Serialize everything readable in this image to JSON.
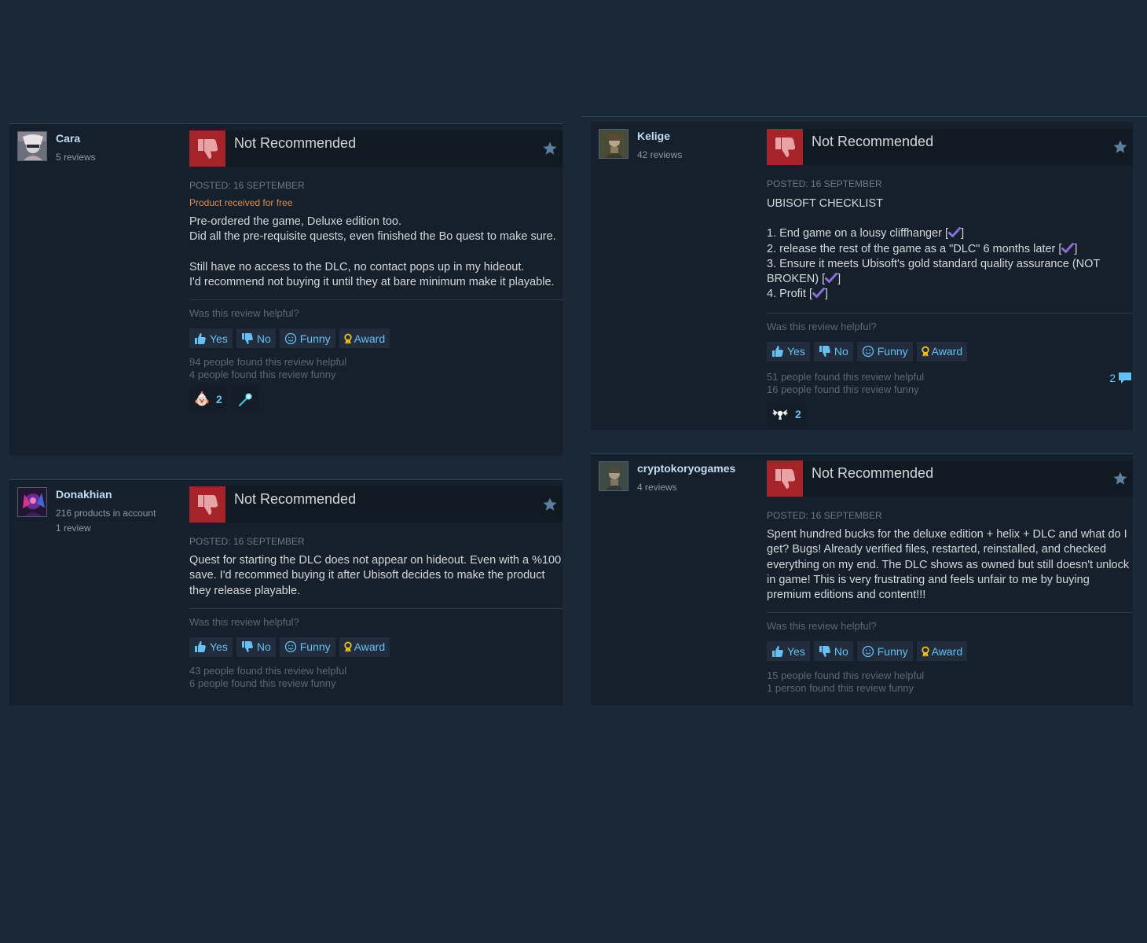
{
  "reviews": [
    {
      "author": {
        "name": "Cara",
        "meta": [
          "5 reviews"
        ]
      },
      "title": "Not Recommended",
      "posted": "POSTED: 16 SEPTEMBER",
      "free_flag": "Product received for free",
      "paragraphs": [
        [
          "Pre-ordered the game, Deluxe edition too.",
          "Did all the pre-requisite quests, even finished the Bo quest to make sure."
        ],
        [
          "Still have no access to the DLC, no contact pops up in my hideout.",
          "I'd recommend not buying it until they at bare minimum make it playable."
        ]
      ],
      "helpful_question": "Was this review helpful?",
      "actions": {
        "yes": "Yes",
        "no": "No",
        "funny": "Funny",
        "award": "Award"
      },
      "helpful_count": "94 people found this review helpful",
      "funny_count": "4 people found this review funny",
      "awards": [
        {
          "icon": "clown-award-icon",
          "count": "2"
        },
        {
          "icon": "comet-award-icon",
          "count": ""
        }
      ]
    },
    {
      "author": {
        "name": "Donakhian",
        "meta": [
          "216 products in account",
          "1 review"
        ]
      },
      "title": "Not Recommended",
      "posted": "POSTED: 16 SEPTEMBER",
      "text": "Quest for starting the DLC does not appear on hideout. Even with a %100 save. I'd recommed buying it after Ubisoft decides to make the product they release playable.",
      "helpful_question": "Was this review helpful?",
      "actions": {
        "yes": "Yes",
        "no": "No",
        "funny": "Funny",
        "award": "Award"
      },
      "helpful_count": "43 people found this review helpful",
      "funny_count": "6 people found this review funny"
    },
    {
      "author": {
        "name": "Kelige",
        "meta": [
          "42 reviews"
        ]
      },
      "title": "Not Recommended",
      "posted": "POSTED: 16 SEPTEMBER",
      "heading": "UBISOFT CHECKLIST",
      "checklist": [
        "1. End game on a lousy cliffhanger [",
        "2. release the rest of the game as a \"DLC\" 6 months later [",
        "3. Ensure it meets Ubisoft's gold standard quality assurance (NOT BROKEN) [",
        "4. Profit ["
      ],
      "checklist_close": "]",
      "helpful_question": "Was this review helpful?",
      "actions": {
        "yes": "Yes",
        "no": "No",
        "funny": "Funny",
        "award": "Award"
      },
      "helpful_count": "51 people found this review helpful",
      "funny_count": "16 people found this review funny",
      "comment_count": "2",
      "awards": [
        {
          "icon": "winged-award-icon",
          "count": "2"
        }
      ]
    },
    {
      "author": {
        "name": "cryptokoryogames",
        "meta": [
          "4 reviews"
        ]
      },
      "title": "Not Recommended",
      "posted": "POSTED: 16 SEPTEMBER",
      "text": "Spent hundred bucks for the deluxe edition + helix + DLC and what do I get? Bugs! Already verified files, restarted, reinstalled, and checked everything on my end. The DLC shows as owned but still doesn't unlock in game! This is very frustrating and feels unfair to me by buying premium editions and content!!!",
      "helpful_question": "Was this review helpful?",
      "actions": {
        "yes": "Yes",
        "no": "No",
        "funny": "Funny",
        "award": "Award"
      },
      "helpful_count": "15 people found this review helpful",
      "funny_count": "1 person found this review funny"
    }
  ]
}
